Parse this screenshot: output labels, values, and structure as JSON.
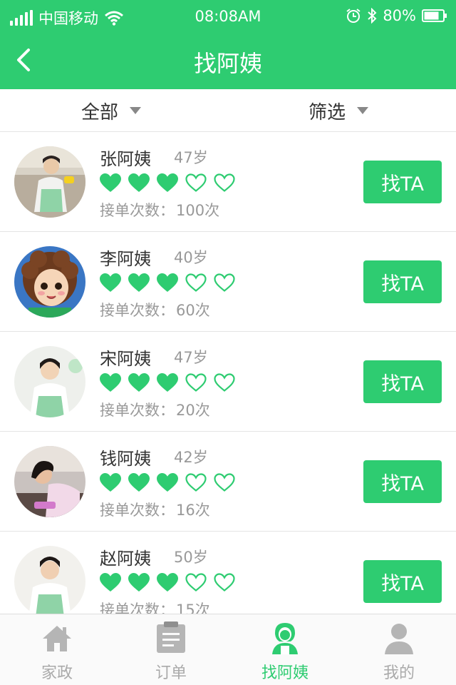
{
  "status_bar": {
    "carrier": "中国移动",
    "time": "08:08AM",
    "battery": "80%"
  },
  "nav": {
    "title": "找阿姨"
  },
  "filters": {
    "all_label": "全部",
    "filter_label": "筛选"
  },
  "colors": {
    "accent": "#2ecc71",
    "heart_filled": "#2ecc71",
    "text_dark": "#333333",
    "text_muted": "#999999"
  },
  "list": {
    "items": [
      {
        "name": "张阿姨",
        "age": "47岁",
        "rating": 3,
        "max_rating": 5,
        "orders_label": "接单次数：",
        "orders": "100次",
        "button": "找TA"
      },
      {
        "name": "李阿姨",
        "age": "40岁",
        "rating": 3,
        "max_rating": 5,
        "orders_label": "接单次数：",
        "orders": "60次",
        "button": "找TA"
      },
      {
        "name": "宋阿姨",
        "age": "47岁",
        "rating": 3,
        "max_rating": 5,
        "orders_label": "接单次数：",
        "orders": "20次",
        "button": "找TA"
      },
      {
        "name": "钱阿姨",
        "age": "42岁",
        "rating": 3,
        "max_rating": 5,
        "orders_label": "接单次数：",
        "orders": "16次",
        "button": "找TA"
      },
      {
        "name": "赵阿姨",
        "age": "50岁",
        "rating": 3,
        "max_rating": 5,
        "orders_label": "接单次数：",
        "orders": "15次",
        "button": "找TA"
      }
    ]
  },
  "tabbar": {
    "items": [
      {
        "label": "家政",
        "icon": "home-icon",
        "active": false
      },
      {
        "label": "订单",
        "icon": "orders-icon",
        "active": false
      },
      {
        "label": "找阿姨",
        "icon": "auntie-icon",
        "active": true
      },
      {
        "label": "我的",
        "icon": "profile-icon",
        "active": false
      }
    ]
  }
}
